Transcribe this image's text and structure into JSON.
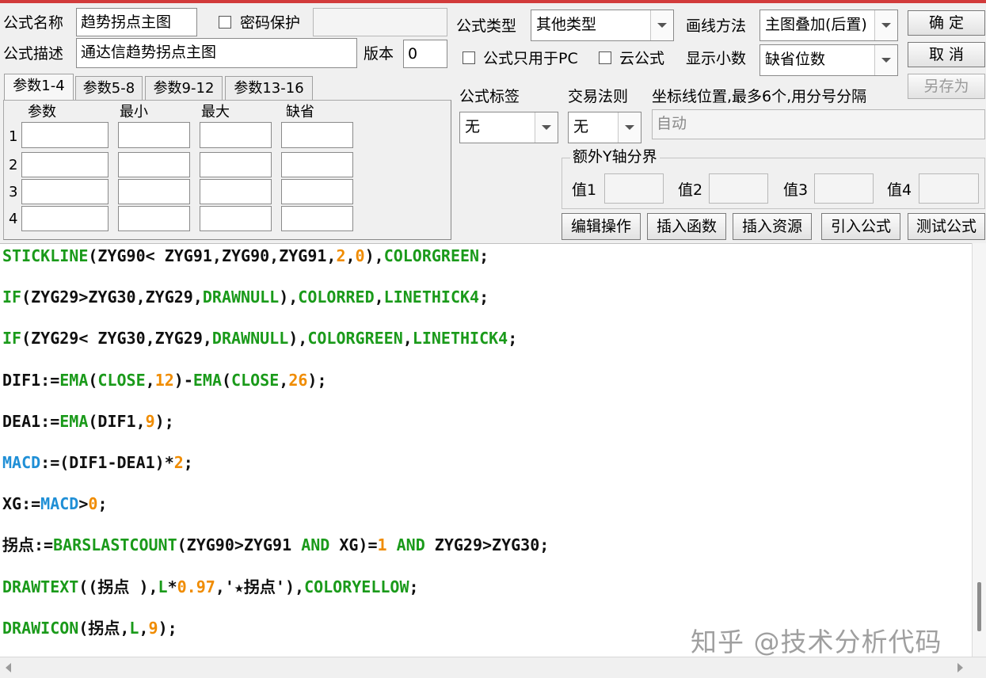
{
  "form": {
    "name_label": "公式名称",
    "name_value": "趋势拐点主图",
    "password_label": "密码保护",
    "password_value": "",
    "desc_label": "公式描述",
    "desc_value": "通达信趋势拐点主图",
    "version_label": "版本",
    "version_value": "0",
    "type_label": "公式类型",
    "type_value": "其他类型",
    "draw_label": "画线方法",
    "draw_value": "主图叠加(后置)",
    "pc_only_label": "公式只用于PC",
    "cloud_label": "云公式",
    "decimal_label": "显示小数",
    "decimal_value": "缺省位数",
    "tag_label": "公式标签",
    "tag_value": "无",
    "trade_label": "交易法则",
    "trade_value": "无",
    "axis_label": "坐标线位置,最多6个,用分号分隔",
    "axis_value": "自动",
    "yaxis_group_label": "额外Y轴分界",
    "yaxis_value_labels": [
      "值1",
      "值2",
      "值3",
      "值4"
    ]
  },
  "buttons": {
    "ok": "确 定",
    "cancel": "取 消",
    "save_as": "另存为",
    "edit_ops": "编辑操作",
    "insert_func": "插入函数",
    "insert_res": "插入资源",
    "import_formula": "引入公式",
    "test_formula": "测试公式"
  },
  "param_tabs": [
    "参数1-4",
    "参数5-8",
    "参数9-12",
    "参数13-16"
  ],
  "param_table": {
    "headers": [
      "参数",
      "最小",
      "最大",
      "缺省"
    ],
    "rows": [
      "1",
      "2",
      "3",
      "4"
    ]
  },
  "colors": {
    "keyword_green": "#1a9a1a",
    "number_orange": "#f08c00",
    "variable_blue": "#1f8fd6",
    "plain_black": "#101010"
  },
  "code_lines": [
    [
      [
        "STICKLINE",
        "green"
      ],
      [
        "(ZYG90< ZYG91,ZYG90,ZYG91,",
        "black"
      ],
      [
        "2",
        "orange"
      ],
      [
        ",",
        "black"
      ],
      [
        "0",
        "orange"
      ],
      [
        "),",
        "black"
      ],
      [
        "COLORGREEN",
        "green"
      ],
      [
        ";",
        "black"
      ]
    ],
    [
      [
        "IF",
        "green"
      ],
      [
        "(ZYG29>ZYG30,ZYG29,",
        "black"
      ],
      [
        "DRAWNULL",
        "green"
      ],
      [
        "),",
        "black"
      ],
      [
        "COLORRED",
        "green"
      ],
      [
        ",",
        "black"
      ],
      [
        "LINETHICK4",
        "green"
      ],
      [
        ";",
        "black"
      ]
    ],
    [
      [
        "IF",
        "green"
      ],
      [
        "(ZYG29< ZYG30,ZYG29,",
        "black"
      ],
      [
        "DRAWNULL",
        "green"
      ],
      [
        "),",
        "black"
      ],
      [
        "COLORGREEN",
        "green"
      ],
      [
        ",",
        "black"
      ],
      [
        "LINETHICK4",
        "green"
      ],
      [
        ";",
        "black"
      ]
    ],
    [
      [
        "DIF1:=",
        "black"
      ],
      [
        "EMA",
        "green"
      ],
      [
        "(",
        "black"
      ],
      [
        "CLOSE",
        "green"
      ],
      [
        ",",
        "black"
      ],
      [
        "12",
        "orange"
      ],
      [
        ")-",
        "black"
      ],
      [
        "EMA",
        "green"
      ],
      [
        "(",
        "black"
      ],
      [
        "CLOSE",
        "green"
      ],
      [
        ",",
        "black"
      ],
      [
        "26",
        "orange"
      ],
      [
        ");",
        "black"
      ]
    ],
    [
      [
        "DEA1:=",
        "black"
      ],
      [
        "EMA",
        "green"
      ],
      [
        "(DIF1,",
        "black"
      ],
      [
        "9",
        "orange"
      ],
      [
        ");",
        "black"
      ]
    ],
    [
      [
        "MACD",
        "blue"
      ],
      [
        ":=(DIF1-DEA1)*",
        "black"
      ],
      [
        "2",
        "orange"
      ],
      [
        ";",
        "black"
      ]
    ],
    [
      [
        "XG:=",
        "black"
      ],
      [
        "MACD",
        "blue"
      ],
      [
        ">",
        "black"
      ],
      [
        "0",
        "orange"
      ],
      [
        ";",
        "black"
      ]
    ],
    [
      [
        "拐点:=",
        "black"
      ],
      [
        "BARSLASTCOUNT",
        "green"
      ],
      [
        "(ZYG90>ZYG91 ",
        "black"
      ],
      [
        "AND",
        "green"
      ],
      [
        " XG)=",
        "black"
      ],
      [
        "1",
        "orange"
      ],
      [
        " ",
        "black"
      ],
      [
        "AND",
        "green"
      ],
      [
        " ZYG29>ZYG30;",
        "black"
      ]
    ],
    [
      [
        "DRAWTEXT",
        "green"
      ],
      [
        "((拐点 ),",
        "black"
      ],
      [
        "L",
        "green"
      ],
      [
        "*",
        "black"
      ],
      [
        "0.97",
        "orange"
      ],
      [
        ",'★拐点'),",
        "black"
      ],
      [
        "COLORYELLOW",
        "green"
      ],
      [
        ";",
        "black"
      ]
    ],
    [
      [
        "DRAWICON",
        "green"
      ],
      [
        "(拐点,",
        "black"
      ],
      [
        "L",
        "green"
      ],
      [
        ",",
        "black"
      ],
      [
        "9",
        "orange"
      ],
      [
        ");",
        "black"
      ]
    ]
  ],
  "watermark": "知乎 @技术分析代码"
}
